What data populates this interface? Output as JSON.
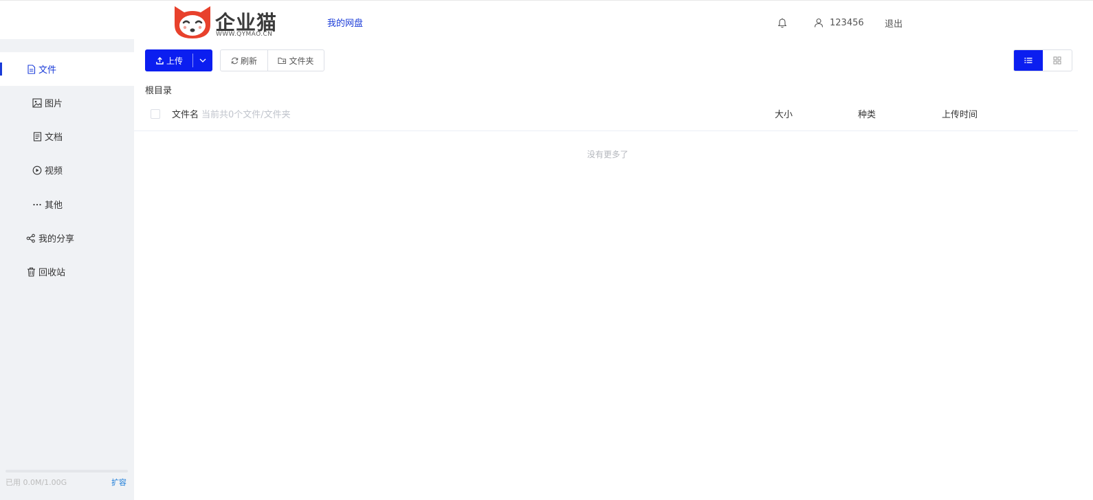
{
  "header": {
    "logo_text": "企业猫",
    "logo_url": "WWW.QYMAO.CN",
    "nav_link": "我的网盘",
    "username": "123456",
    "logout": "退出"
  },
  "sidebar": {
    "items": [
      {
        "label": "文件",
        "icon": "file-icon",
        "active": true
      },
      {
        "label": "图片",
        "icon": "image-icon"
      },
      {
        "label": "文档",
        "icon": "document-icon"
      },
      {
        "label": "视频",
        "icon": "play-circle-icon"
      },
      {
        "label": "其他",
        "icon": "more-icon"
      },
      {
        "label": "我的分享",
        "icon": "share-icon"
      },
      {
        "label": "回收站",
        "icon": "trash-icon"
      }
    ],
    "storage": {
      "text": "已用 0.0M/1.00G",
      "used_fraction": 0.0,
      "expand": "扩容"
    }
  },
  "toolbar": {
    "upload": "上传",
    "refresh": "刷新",
    "folder": "文件夹"
  },
  "breadcrumb": "根目录",
  "table": {
    "columns": {
      "name": "文件名",
      "size": "大小",
      "type": "种类",
      "time": "上传时间"
    },
    "count_text": "当前共0个文件/文件夹",
    "empty_text": "没有更多了"
  },
  "colors": {
    "accent": "#0b1ef0",
    "link": "#1a3bd8",
    "logo_red": "#e8412c",
    "sidebar_bg": "#f0f2f5"
  }
}
